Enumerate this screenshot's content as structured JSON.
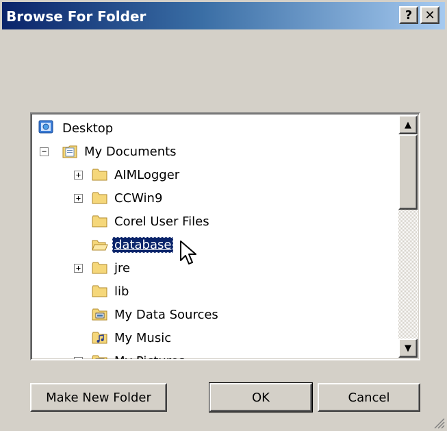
{
  "window": {
    "title": "Browse For Folder",
    "help_label": "?",
    "close_label": "✕"
  },
  "tree": {
    "items": [
      {
        "label": "Desktop",
        "icon": "desktop-icon",
        "expander": ""
      },
      {
        "label": "My Documents",
        "icon": "my-documents-icon",
        "expander": "−"
      },
      {
        "label": "AIMLogger",
        "icon": "folder-icon",
        "expander": "+"
      },
      {
        "label": "CCWin9",
        "icon": "folder-icon",
        "expander": "+"
      },
      {
        "label": "Corel User Files",
        "icon": "folder-icon",
        "expander": ""
      },
      {
        "label": "database",
        "icon": "folder-icon",
        "expander": "",
        "selected": true
      },
      {
        "label": "jre",
        "icon": "folder-icon",
        "expander": "+"
      },
      {
        "label": "lib",
        "icon": "folder-icon",
        "expander": ""
      },
      {
        "label": "My Data Sources",
        "icon": "data-sources-icon",
        "expander": ""
      },
      {
        "label": "My Music",
        "icon": "music-folder-icon",
        "expander": ""
      },
      {
        "label": "My Pictures",
        "icon": "pictures-folder-icon",
        "expander": "+"
      }
    ]
  },
  "scrollbar": {
    "up_arrow": "▲",
    "down_arrow": "▼"
  },
  "buttons": {
    "make_new_folder": "Make New Folder",
    "ok": "OK",
    "cancel": "Cancel"
  },
  "colors": {
    "title_active": "#0a246a",
    "dialog_face": "#d4d0c8",
    "selection": "#0a246a"
  }
}
